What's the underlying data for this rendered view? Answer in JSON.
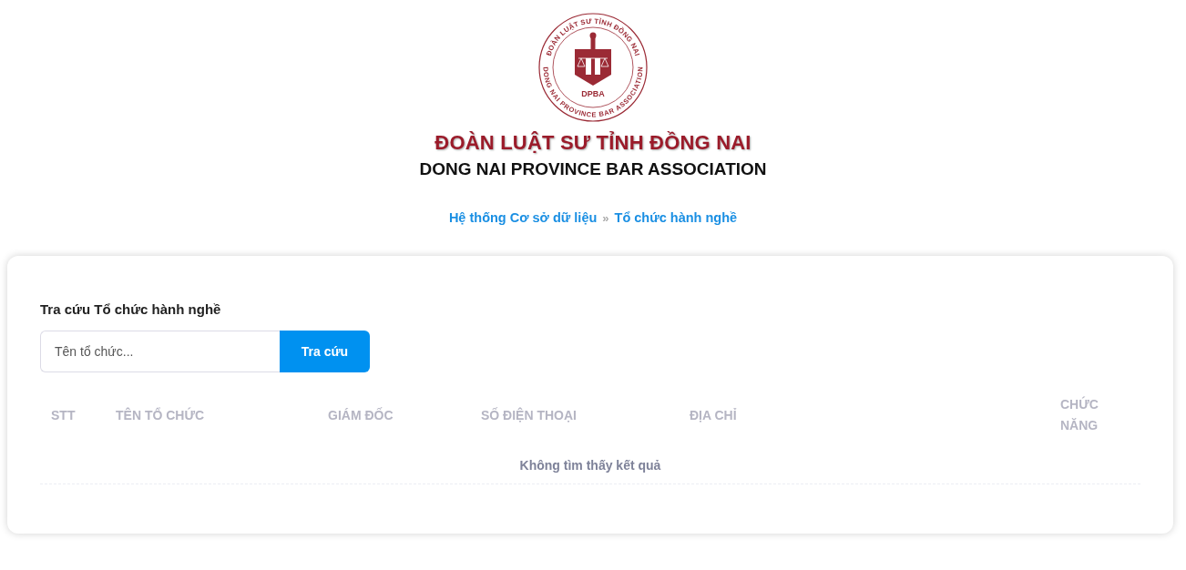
{
  "logo": {
    "top_text": "ĐOÀN LUẬT SƯ TỈNH ĐỒNG NAI",
    "initials": "DPBA",
    "bottom_text": "DONG NAI PROVINCE BAR ASSOCIATION"
  },
  "title": "ĐOÀN LUẬT SƯ TỈNH ĐỒNG NAI",
  "subtitle": "DONG NAI PROVINCE BAR ASSOCIATION",
  "breadcrumb": {
    "items": [
      "Hệ thống Cơ sở dữ liệu",
      "Tổ chức hành nghề"
    ],
    "separator": "»"
  },
  "search": {
    "heading": "Tra cứu Tổ chức hành nghề",
    "placeholder": "Tên tổ chức...",
    "button": "Tra cứu"
  },
  "table": {
    "columns": [
      "STT",
      "TÊN TỔ CHỨC",
      "GIÁM ĐỐC",
      "SỐ ĐIỆN THOẠI",
      "ĐỊA CHỈ",
      "CHỨC NĂNG"
    ],
    "empty_message": "Không tìm thấy kết quả"
  }
}
